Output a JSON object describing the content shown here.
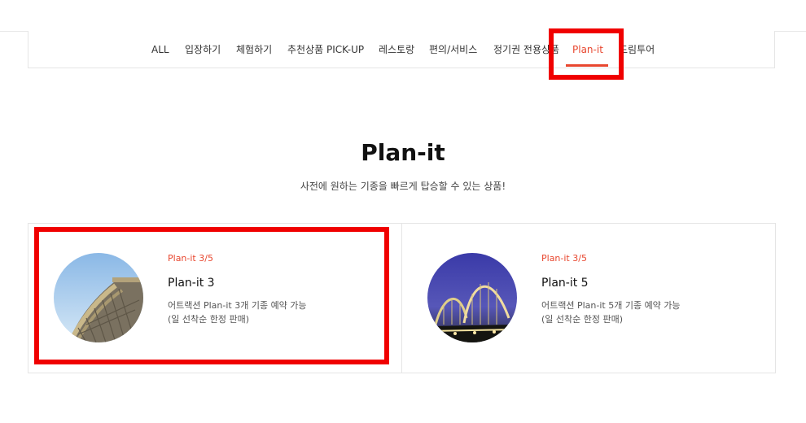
{
  "tabs": [
    {
      "label": "ALL",
      "active": false
    },
    {
      "label": "입장하기",
      "active": false
    },
    {
      "label": "체험하기",
      "active": false
    },
    {
      "label": "추천상품 PICK-UP",
      "active": false
    },
    {
      "label": "레스토랑",
      "active": false
    },
    {
      "label": "편의/서비스",
      "active": false
    },
    {
      "label": "정기권 전용상품",
      "active": false
    },
    {
      "label": "Plan-it",
      "active": true
    },
    {
      "label": "드림투어",
      "active": false
    }
  ],
  "section": {
    "title": "Plan-it",
    "subtitle": "사전에 원하는 기종을 빠르게 탑승할 수 있는 상품!"
  },
  "cards": [
    {
      "tag": "Plan-it 3/5",
      "title": "Plan-it 3",
      "desc_line1": "어트랙션 Plan-it 3개 기종 예약 가능",
      "desc_line2": "(일 선착순 한정 판매)",
      "image": "roller-coaster-daytime"
    },
    {
      "tag": "Plan-it 3/5",
      "title": "Plan-it 5",
      "desc_line1": "어트랙션 Plan-it 5개 기종 예약 가능",
      "desc_line2": "(일 선착순 한정 판매)",
      "image": "roller-coaster-night"
    }
  ],
  "colors": {
    "accent": "#e8472f",
    "highlight": "#f00000",
    "border": "#e5e5e5"
  }
}
